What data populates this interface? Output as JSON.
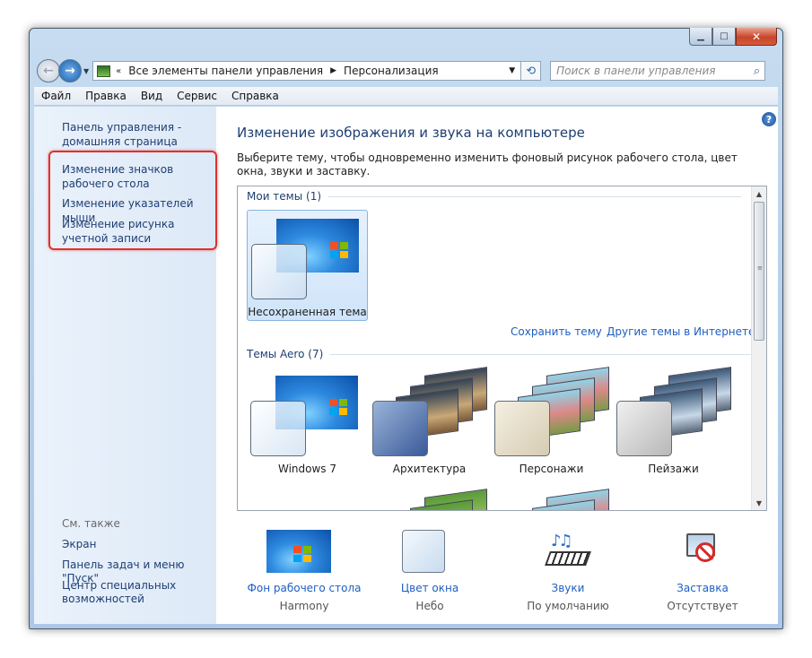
{
  "window": {
    "caption_buttons": {
      "minimize": "▁",
      "maximize": "□",
      "close": "✕"
    }
  },
  "address_bar": {
    "sep": "«",
    "crumb1": "Все элементы панели управления",
    "arrow": "▶",
    "crumb2": "Персонализация",
    "dropdown": "▼",
    "refresh": "⟲",
    "search_placeholder": "Поиск в панели управления",
    "search_icon": "⌕"
  },
  "menu": [
    "Файл",
    "Правка",
    "Вид",
    "Сервис",
    "Справка"
  ],
  "sidebar": {
    "home": "Панель управления - домашняя страница",
    "links": [
      "Изменение значков рабочего стола",
      "Изменение указателей мыши",
      "Изменение рисунка учетной записи"
    ],
    "see_also": "См. также",
    "see_also_links": [
      "Экран",
      "Панель задач и меню \"Пуск\"",
      "Центр специальных возможностей"
    ]
  },
  "main": {
    "help": "?",
    "title": "Изменение изображения и звука на компьютере",
    "description": "Выберите тему, чтобы одновременно изменить фоновый рисунок рабочего стола, цвет окна, звуки и заставку."
  },
  "themes": {
    "my_themes_header": "Мои темы (1)",
    "aero_header": "Темы Aero (7)",
    "unsaved": "Несохраненная тема",
    "save_link": "Сохранить тему",
    "online_link": "Другие темы в Интернете",
    "aero": [
      "Windows 7",
      "Архитектура",
      "Персонажи",
      "Пейзажи"
    ]
  },
  "bottom": [
    {
      "title": "Фон рабочего стола",
      "value": "Harmony"
    },
    {
      "title": "Цвет окна",
      "value": "Небо"
    },
    {
      "title": "Звуки",
      "value": "По умолчанию"
    },
    {
      "title": "Заставка",
      "value": "Отсутствует"
    }
  ],
  "icons": {
    "back": "back-arrow-icon",
    "forward": "forward-arrow-icon",
    "control_panel": "control-panel-icon",
    "help": "help-icon",
    "sounds": "sounds-icon",
    "screensaver": "screensaver-icon"
  },
  "colors": {
    "link": "#1e3e72",
    "highlight_border": "#e2302a",
    "accent_link": "#1e5ec2"
  }
}
